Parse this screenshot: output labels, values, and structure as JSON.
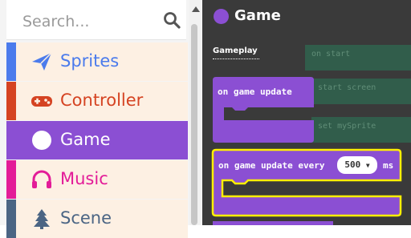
{
  "search": {
    "placeholder": "Search..."
  },
  "categories": [
    {
      "label": "Sprites",
      "color": "#4b7bec",
      "icon": "paper-plane-icon",
      "selected": false
    },
    {
      "label": "Controller",
      "color": "#d54322",
      "icon": "gamepad-icon",
      "selected": false
    },
    {
      "label": "Game",
      "color": "#8b4fd3",
      "icon": "circle-icon",
      "selected": true
    },
    {
      "label": "Music",
      "color": "#e31c98",
      "icon": "headphones-icon",
      "selected": false
    },
    {
      "label": "Scene",
      "color": "#4b6584",
      "icon": "tree-icon",
      "selected": false
    }
  ],
  "flyout": {
    "title": "Game",
    "section": "Gameplay",
    "blocks": [
      {
        "text": "on game update"
      },
      {
        "text": "on game update every",
        "value": "500",
        "unit": "ms"
      }
    ],
    "background_snippets": [
      "on start",
      "start screen",
      "set mySprite"
    ]
  },
  "colors": {
    "game": "#8b4fd3",
    "highlight": "#ffef00",
    "workspace": "#3a3a3a"
  }
}
